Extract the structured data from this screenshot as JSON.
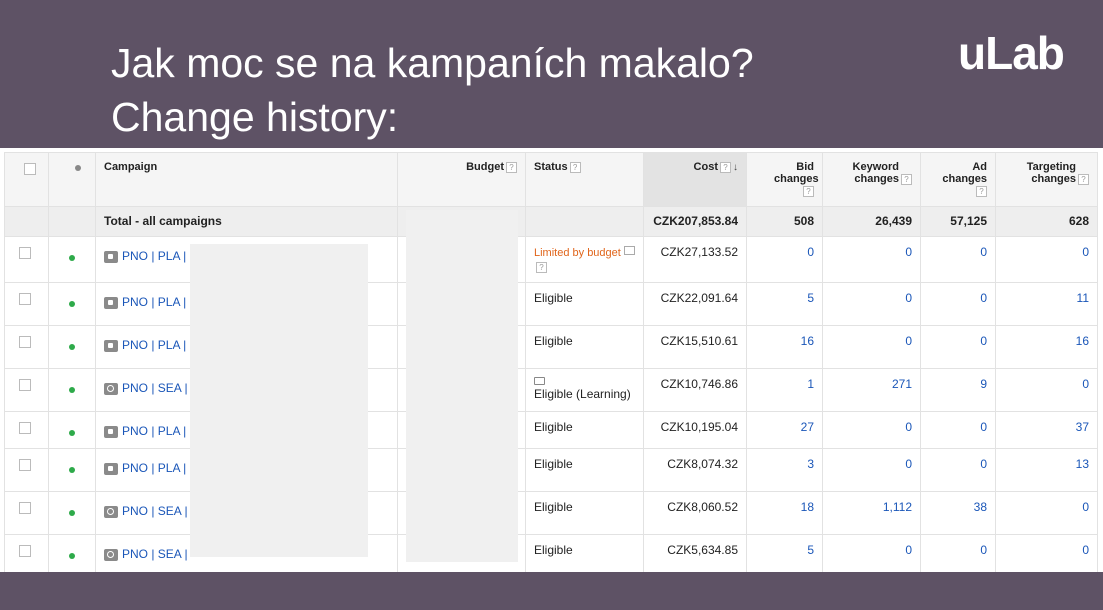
{
  "header": {
    "title_line1": "Jak moc se na kampaních makalo?",
    "title_line2": "Change history:",
    "logo": "uLab"
  },
  "table": {
    "columns": {
      "campaign": "Campaign",
      "budget": "Budget",
      "status": "Status",
      "cost": "Cost",
      "bid": "Bid changes",
      "keyword": "Keyword changes",
      "ad": "Ad changes",
      "targeting": "Targeting changes"
    },
    "help_mark": "?",
    "sort_arrow": "↓",
    "total": {
      "label": "Total - all campaigns",
      "cost": "CZK207,853.84",
      "bid": "508",
      "keyword": "26,439",
      "ad": "57,125",
      "targeting": "628"
    },
    "rows": [
      {
        "icon": "shopping-tag-icon",
        "campaign": "PNO | PLA |",
        "status": "Limited by budget",
        "status_type": "limited",
        "cost": "CZK27,133.52",
        "bid": "0",
        "keyword": "0",
        "ad": "0",
        "targeting": "0"
      },
      {
        "icon": "shopping-tag-icon",
        "campaign": "PNO | PLA |",
        "status": "Eligible",
        "status_type": "eligible",
        "cost": "CZK22,091.64",
        "bid": "5",
        "keyword": "0",
        "ad": "0",
        "targeting": "11"
      },
      {
        "icon": "shopping-tag-icon",
        "campaign": "PNO | PLA |",
        "status": "Eligible",
        "status_type": "eligible",
        "cost": "CZK15,510.61",
        "bid": "16",
        "keyword": "0",
        "ad": "0",
        "targeting": "16"
      },
      {
        "icon": "search-icon",
        "campaign": "PNO | SEA |",
        "status": "Eligible (Learning)",
        "status_type": "learning",
        "cost": "CZK10,746.86",
        "bid": "1",
        "keyword": "271",
        "ad": "9",
        "targeting": "0"
      },
      {
        "icon": "shopping-tag-icon",
        "campaign": "PNO | PLA |",
        "status": "Eligible",
        "status_type": "eligible",
        "cost": "CZK10,195.04",
        "bid": "27",
        "keyword": "0",
        "ad": "0",
        "targeting": "37"
      },
      {
        "icon": "shopping-tag-icon",
        "campaign": "PNO | PLA |",
        "status": "Eligible",
        "status_type": "eligible",
        "cost": "CZK8,074.32",
        "bid": "3",
        "keyword": "0",
        "ad": "0",
        "targeting": "13"
      },
      {
        "icon": "search-icon",
        "campaign": "PNO | SEA |",
        "status": "Eligible",
        "status_type": "eligible",
        "cost": "CZK8,060.52",
        "bid": "18",
        "keyword": "1,112",
        "ad": "38",
        "targeting": "0"
      },
      {
        "icon": "search-icon",
        "campaign": "PNO | SEA |",
        "status": "Eligible",
        "status_type": "eligible",
        "cost": "CZK5,634.85",
        "bid": "5",
        "keyword": "0",
        "ad": "0",
        "targeting": "0"
      }
    ]
  },
  "colors": {
    "header_bg": "#5e5265",
    "link": "#1a56b8",
    "limited": "#e0651b",
    "active_dot": "#2eaa4a"
  }
}
